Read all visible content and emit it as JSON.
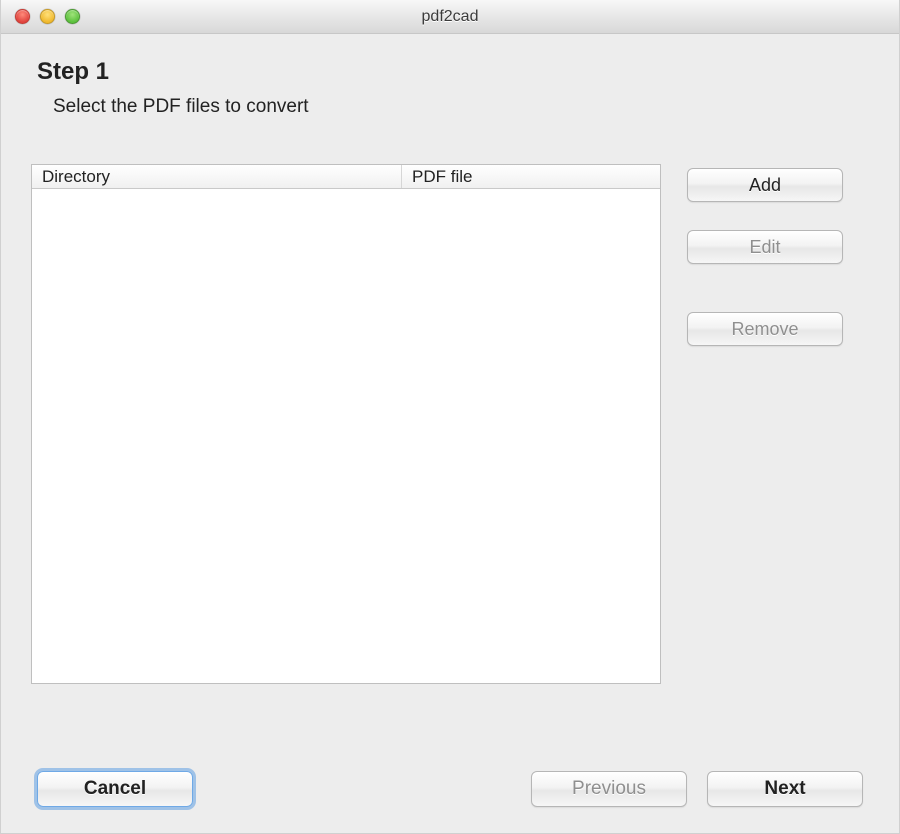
{
  "window": {
    "title": "pdf2cad"
  },
  "step": {
    "title": "Step 1",
    "description": "Select the PDF files to convert"
  },
  "table": {
    "columns": {
      "directory": "Directory",
      "pdffile": "PDF file"
    }
  },
  "side": {
    "add": "Add",
    "edit": "Edit",
    "remove": "Remove"
  },
  "footer": {
    "cancel": "Cancel",
    "previous": "Previous",
    "next": "Next"
  }
}
